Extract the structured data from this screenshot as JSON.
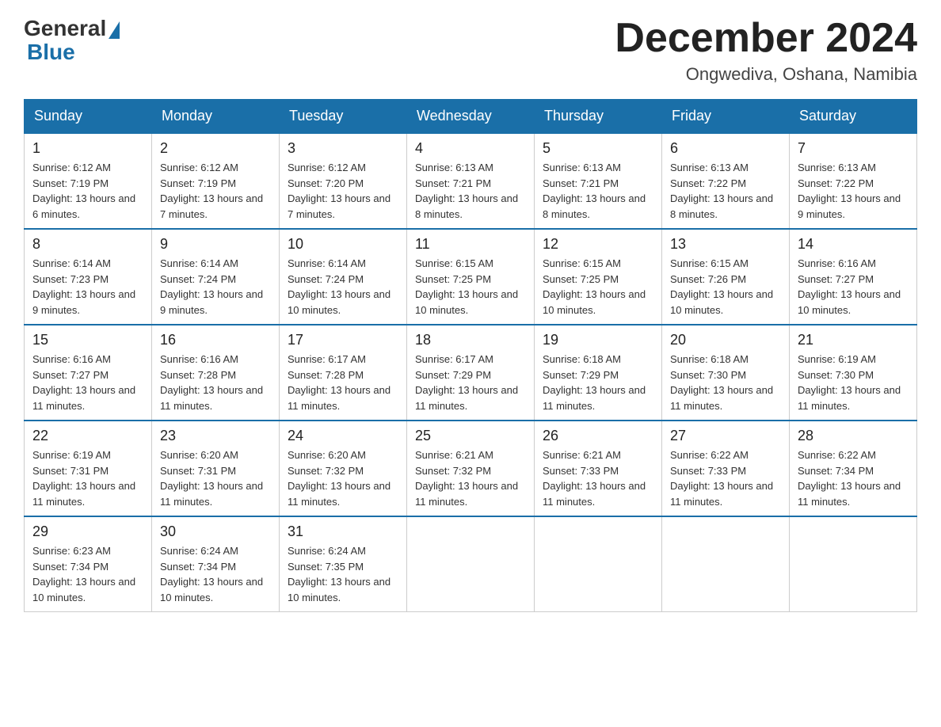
{
  "logo": {
    "general": "General",
    "blue": "Blue"
  },
  "header": {
    "month": "December 2024",
    "location": "Ongwediva, Oshana, Namibia"
  },
  "weekdays": [
    "Sunday",
    "Monday",
    "Tuesday",
    "Wednesday",
    "Thursday",
    "Friday",
    "Saturday"
  ],
  "weeks": [
    [
      {
        "day": "1",
        "sunrise": "6:12 AM",
        "sunset": "7:19 PM",
        "daylight": "13 hours and 6 minutes."
      },
      {
        "day": "2",
        "sunrise": "6:12 AM",
        "sunset": "7:19 PM",
        "daylight": "13 hours and 7 minutes."
      },
      {
        "day": "3",
        "sunrise": "6:12 AM",
        "sunset": "7:20 PM",
        "daylight": "13 hours and 7 minutes."
      },
      {
        "day": "4",
        "sunrise": "6:13 AM",
        "sunset": "7:21 PM",
        "daylight": "13 hours and 8 minutes."
      },
      {
        "day": "5",
        "sunrise": "6:13 AM",
        "sunset": "7:21 PM",
        "daylight": "13 hours and 8 minutes."
      },
      {
        "day": "6",
        "sunrise": "6:13 AM",
        "sunset": "7:22 PM",
        "daylight": "13 hours and 8 minutes."
      },
      {
        "day": "7",
        "sunrise": "6:13 AM",
        "sunset": "7:22 PM",
        "daylight": "13 hours and 9 minutes."
      }
    ],
    [
      {
        "day": "8",
        "sunrise": "6:14 AM",
        "sunset": "7:23 PM",
        "daylight": "13 hours and 9 minutes."
      },
      {
        "day": "9",
        "sunrise": "6:14 AM",
        "sunset": "7:24 PM",
        "daylight": "13 hours and 9 minutes."
      },
      {
        "day": "10",
        "sunrise": "6:14 AM",
        "sunset": "7:24 PM",
        "daylight": "13 hours and 10 minutes."
      },
      {
        "day": "11",
        "sunrise": "6:15 AM",
        "sunset": "7:25 PM",
        "daylight": "13 hours and 10 minutes."
      },
      {
        "day": "12",
        "sunrise": "6:15 AM",
        "sunset": "7:25 PM",
        "daylight": "13 hours and 10 minutes."
      },
      {
        "day": "13",
        "sunrise": "6:15 AM",
        "sunset": "7:26 PM",
        "daylight": "13 hours and 10 minutes."
      },
      {
        "day": "14",
        "sunrise": "6:16 AM",
        "sunset": "7:27 PM",
        "daylight": "13 hours and 10 minutes."
      }
    ],
    [
      {
        "day": "15",
        "sunrise": "6:16 AM",
        "sunset": "7:27 PM",
        "daylight": "13 hours and 11 minutes."
      },
      {
        "day": "16",
        "sunrise": "6:16 AM",
        "sunset": "7:28 PM",
        "daylight": "13 hours and 11 minutes."
      },
      {
        "day": "17",
        "sunrise": "6:17 AM",
        "sunset": "7:28 PM",
        "daylight": "13 hours and 11 minutes."
      },
      {
        "day": "18",
        "sunrise": "6:17 AM",
        "sunset": "7:29 PM",
        "daylight": "13 hours and 11 minutes."
      },
      {
        "day": "19",
        "sunrise": "6:18 AM",
        "sunset": "7:29 PM",
        "daylight": "13 hours and 11 minutes."
      },
      {
        "day": "20",
        "sunrise": "6:18 AM",
        "sunset": "7:30 PM",
        "daylight": "13 hours and 11 minutes."
      },
      {
        "day": "21",
        "sunrise": "6:19 AM",
        "sunset": "7:30 PM",
        "daylight": "13 hours and 11 minutes."
      }
    ],
    [
      {
        "day": "22",
        "sunrise": "6:19 AM",
        "sunset": "7:31 PM",
        "daylight": "13 hours and 11 minutes."
      },
      {
        "day": "23",
        "sunrise": "6:20 AM",
        "sunset": "7:31 PM",
        "daylight": "13 hours and 11 minutes."
      },
      {
        "day": "24",
        "sunrise": "6:20 AM",
        "sunset": "7:32 PM",
        "daylight": "13 hours and 11 minutes."
      },
      {
        "day": "25",
        "sunrise": "6:21 AM",
        "sunset": "7:32 PM",
        "daylight": "13 hours and 11 minutes."
      },
      {
        "day": "26",
        "sunrise": "6:21 AM",
        "sunset": "7:33 PM",
        "daylight": "13 hours and 11 minutes."
      },
      {
        "day": "27",
        "sunrise": "6:22 AM",
        "sunset": "7:33 PM",
        "daylight": "13 hours and 11 minutes."
      },
      {
        "day": "28",
        "sunrise": "6:22 AM",
        "sunset": "7:34 PM",
        "daylight": "13 hours and 11 minutes."
      }
    ],
    [
      {
        "day": "29",
        "sunrise": "6:23 AM",
        "sunset": "7:34 PM",
        "daylight": "13 hours and 10 minutes."
      },
      {
        "day": "30",
        "sunrise": "6:24 AM",
        "sunset": "7:34 PM",
        "daylight": "13 hours and 10 minutes."
      },
      {
        "day": "31",
        "sunrise": "6:24 AM",
        "sunset": "7:35 PM",
        "daylight": "13 hours and 10 minutes."
      },
      null,
      null,
      null,
      null
    ]
  ]
}
